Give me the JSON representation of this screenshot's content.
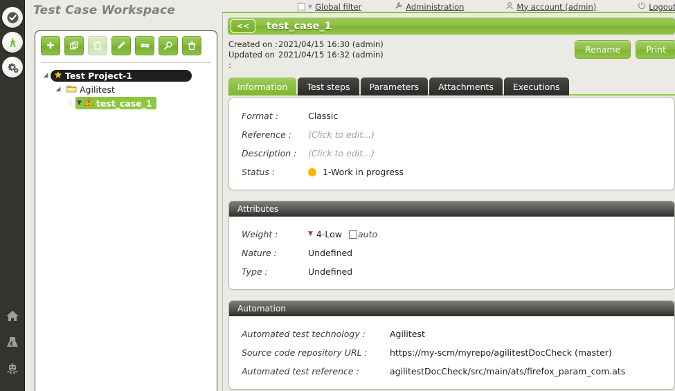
{
  "colors": {
    "accent_green": "#8dc63f",
    "rail_dark": "#343330",
    "status_amber": "#f5b50a",
    "weight_purple": "#8d3a95",
    "page_bg": "#ebeae4"
  },
  "rail": {
    "top_icons": [
      {
        "name": "check-circle-icon",
        "title": "Validation"
      },
      {
        "name": "agilitest-logo-icon",
        "title": "Agilitest"
      },
      {
        "name": "gears-icon",
        "title": "Settings"
      }
    ],
    "bottom_icons": [
      {
        "name": "home-icon",
        "title": "Home"
      },
      {
        "name": "test-lab-icon",
        "title": "Campaigns"
      },
      {
        "name": "robot-icon",
        "title": "Automation"
      }
    ]
  },
  "workspace": {
    "title": "Test Case Workspace",
    "toolbar": [
      {
        "name": "add-button",
        "icon": "plus-icon",
        "label": "Add",
        "disabled": false
      },
      {
        "name": "copy-button",
        "icon": "copy-icon",
        "label": "Copy",
        "disabled": false
      },
      {
        "name": "paste-button",
        "icon": "paste-icon",
        "label": "Paste",
        "disabled": true
      },
      {
        "name": "edit-button",
        "icon": "pencil-icon",
        "label": "Rename",
        "disabled": false
      },
      {
        "name": "move-button",
        "icon": "move-arrows-icon",
        "label": "Move",
        "disabled": false
      },
      {
        "name": "search-button",
        "icon": "magnifier-icon",
        "label": "Search",
        "disabled": false
      },
      {
        "name": "delete-button",
        "icon": "trash-icon",
        "label": "Delete",
        "disabled": false
      }
    ],
    "tree": [
      {
        "label": "Test Project-1",
        "icon": "star-icon",
        "level": 0,
        "type": "project",
        "selected": false,
        "expanded": true
      },
      {
        "label": "Agilitest",
        "icon": "folder-icon",
        "level": 1,
        "type": "folder",
        "selected": false,
        "expanded": true
      },
      {
        "label": "test_case_1",
        "icon": "warning-icon",
        "level": 2,
        "type": "testcase",
        "selected": true,
        "expanded": false
      }
    ]
  },
  "topnav": {
    "items": [
      {
        "name": "global-filter",
        "label": "Global filter",
        "icon": "checkbox-icon",
        "has_caret": true
      },
      {
        "name": "administration",
        "label": "Administration",
        "icon": "wrench-icon",
        "has_caret": false
      },
      {
        "name": "my-account",
        "label": "My account (admin)",
        "icon": "user-icon",
        "has_caret": false
      },
      {
        "name": "logout",
        "label": "Logout",
        "icon": "power-icon",
        "has_caret": false
      }
    ]
  },
  "detail": {
    "back_label": "<<",
    "title": "test_case_1",
    "meta": [
      {
        "key": "Created on :",
        "value": "2021/04/15 16:30 (admin)"
      },
      {
        "key": "Updated on :",
        "value": "2021/04/15 16:32 (admin)"
      }
    ],
    "actions": [
      {
        "name": "rename-button",
        "label": "Rename"
      },
      {
        "name": "print-button",
        "label": "Print"
      }
    ],
    "tabs": [
      {
        "name": "tab-information",
        "label": "Information",
        "active": true
      },
      {
        "name": "tab-test-steps",
        "label": "Test steps",
        "active": false
      },
      {
        "name": "tab-parameters",
        "label": "Parameters",
        "active": false
      },
      {
        "name": "tab-attachments",
        "label": "Attachments",
        "active": false
      },
      {
        "name": "tab-executions",
        "label": "Executions",
        "active": false
      }
    ],
    "information": {
      "rows": [
        {
          "key": "Format :",
          "value": "Classic",
          "muted": false
        },
        {
          "key": "Reference :",
          "value": "(Click to edit...)",
          "muted": true
        },
        {
          "key": "Description :",
          "value": "(Click to edit...)",
          "muted": true
        }
      ],
      "status": {
        "key": "Status :",
        "value": "1-Work in progress",
        "color": "#f5b50a"
      }
    },
    "attributes": {
      "header": "Attributes",
      "weight": {
        "key": "Weight :",
        "value": "4-Low",
        "auto_label": "auto",
        "auto_checked": false
      },
      "rows": [
        {
          "key": "Nature :",
          "value": "Undefined"
        },
        {
          "key": "Type  :",
          "value": "Undefined"
        }
      ]
    },
    "automation": {
      "header": "Automation",
      "rows": [
        {
          "key": "Automated test technology  :",
          "value": "Agilitest"
        },
        {
          "key": "Source code repository URL :",
          "value": "https://my-scm/myrepo/agilitestDocCheck (master)"
        },
        {
          "key": "Automated test reference :",
          "value": "agilitestDocCheck/src/main/ats/firefox_param_com.ats"
        }
      ]
    }
  }
}
